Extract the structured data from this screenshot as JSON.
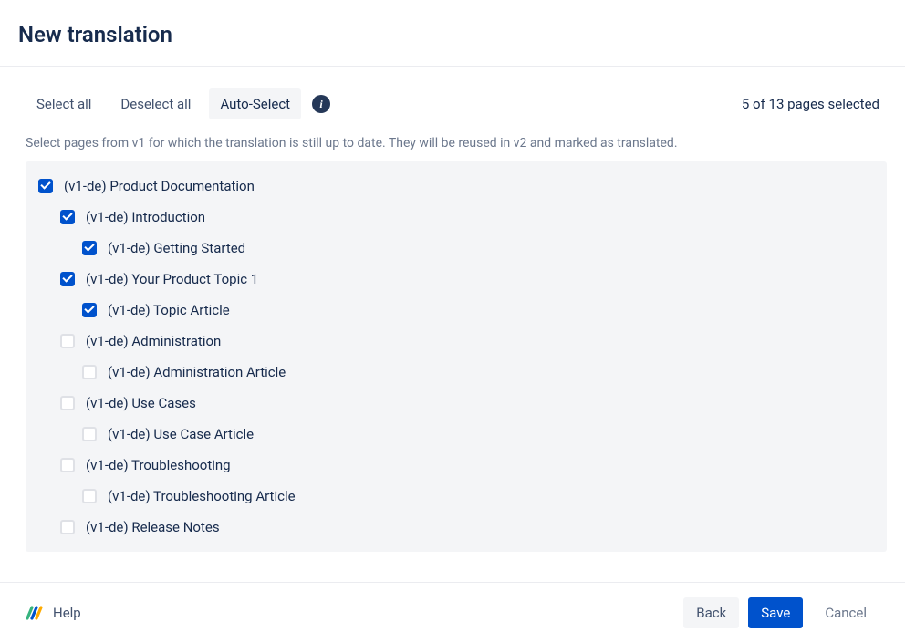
{
  "header": {
    "title": "New translation"
  },
  "toolbar": {
    "select_all": "Select all",
    "deselect_all": "Deselect all",
    "auto_select": "Auto-Select",
    "status": "5 of 13 pages selected"
  },
  "hint": "Select pages from v1 for which the translation is still up to date. They will be reused in v2 and marked as translated.",
  "tree": [
    {
      "label": "(v1-de) Product Documentation",
      "depth": 0,
      "checked": true
    },
    {
      "label": "(v1-de) Introduction",
      "depth": 1,
      "checked": true
    },
    {
      "label": "(v1-de) Getting Started",
      "depth": 2,
      "checked": true
    },
    {
      "label": "(v1-de) Your Product Topic 1",
      "depth": 1,
      "checked": true
    },
    {
      "label": "(v1-de) Topic Article",
      "depth": 2,
      "checked": true
    },
    {
      "label": "(v1-de) Administration",
      "depth": 1,
      "checked": false
    },
    {
      "label": "(v1-de) Administration Article",
      "depth": 2,
      "checked": false
    },
    {
      "label": "(v1-de) Use Cases",
      "depth": 1,
      "checked": false
    },
    {
      "label": "(v1-de) Use Case Article",
      "depth": 2,
      "checked": false
    },
    {
      "label": "(v1-de) Troubleshooting",
      "depth": 1,
      "checked": false
    },
    {
      "label": "(v1-de) Troubleshooting Article",
      "depth": 2,
      "checked": false
    },
    {
      "label": "(v1-de) Release Notes",
      "depth": 1,
      "checked": false
    }
  ],
  "footer": {
    "help": "Help",
    "back": "Back",
    "save": "Save",
    "cancel": "Cancel"
  }
}
